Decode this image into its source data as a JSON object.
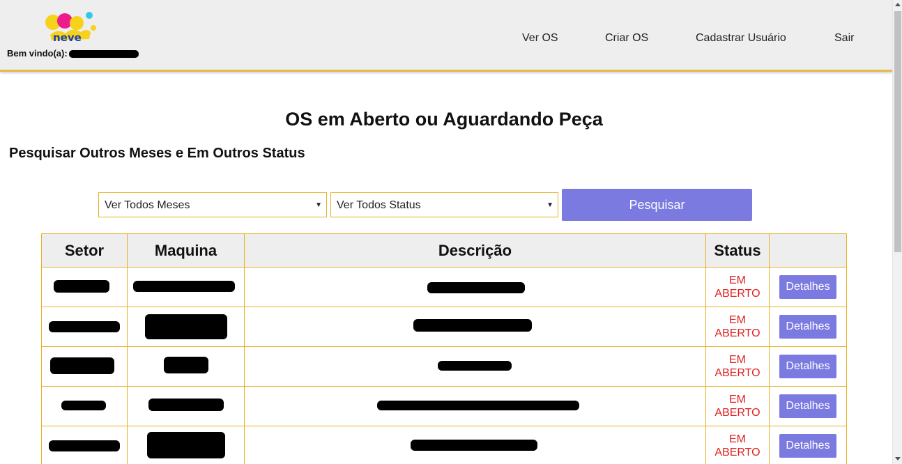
{
  "header": {
    "logo_text": "sol neve",
    "welcome_label": "Bem vindo(a):",
    "nav": [
      {
        "label": "Ver OS"
      },
      {
        "label": "Criar OS"
      },
      {
        "label": "Cadastrar Usuário"
      },
      {
        "label": "Sair"
      }
    ]
  },
  "page_title": "OS em Aberto ou Aguardando Peça",
  "subtitle": "Pesquisar Outros Meses e Em Outros Status",
  "filters": {
    "month_selected": "Ver Todos Meses",
    "status_selected": "Ver Todos Status",
    "search_label": "Pesquisar"
  },
  "table": {
    "headers": [
      "Setor",
      "Maquina",
      "Descrição",
      "Status",
      ""
    ],
    "rows": [
      {
        "status_line1": "EM",
        "status_line2": "ABERTO",
        "action": "Detalhes"
      },
      {
        "status_line1": "EM",
        "status_line2": "ABERTO",
        "action": "Detalhes"
      },
      {
        "status_line1": "EM",
        "status_line2": "ABERTO",
        "action": "Detalhes"
      },
      {
        "status_line1": "EM",
        "status_line2": "ABERTO",
        "action": "Detalhes"
      },
      {
        "status_line1": "EM",
        "status_line2": "ABERTO",
        "action": "Detalhes"
      }
    ]
  },
  "colors": {
    "accent": "#7b7ae0",
    "border": "#e8b020",
    "status_open": "#e02020"
  }
}
